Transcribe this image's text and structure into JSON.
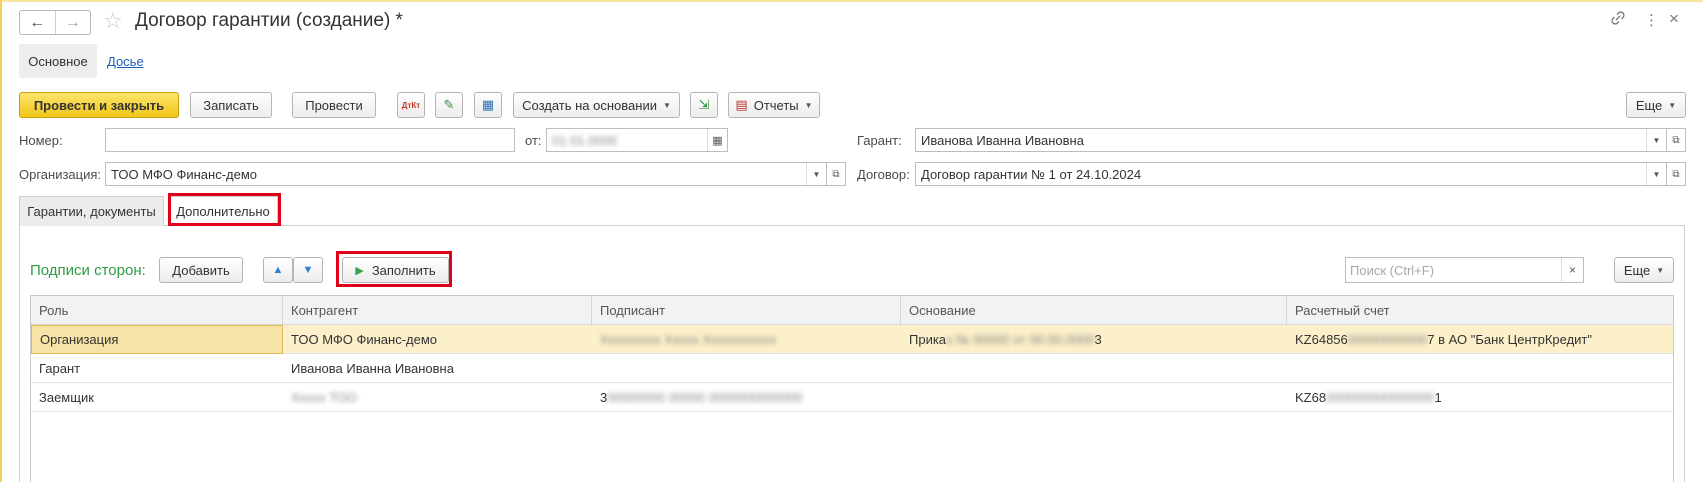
{
  "window": {
    "title": "Договор гарантии (создание) *",
    "back_icon": "←",
    "forward_icon": "→",
    "star_icon": "☆",
    "link_icon": "🔗",
    "more_icon": "⋮",
    "close_icon": "×"
  },
  "top_tabs": {
    "main": "Основное",
    "dossier": "Досье"
  },
  "toolbar": {
    "post_close": "Провести и закрыть",
    "save": "Записать",
    "post": "Провести",
    "create_based": "Создать на основании",
    "reports": "Отчеты",
    "more": "Еще",
    "dt_kt_icon": "ДтКт",
    "edit_icon": "✎",
    "struct_icon": "▦",
    "export_icon": "⇲",
    "report_icon": "▤"
  },
  "form": {
    "number_label": "Номер:",
    "number_value": "",
    "date_label": "от:",
    "date_value": "01.01.0000",
    "guarantor_label": "Гарант:",
    "guarantor_value": "Иванова Иванна Ивановна",
    "org_label": "Организация:",
    "org_value": "ТОО МФО Финанс-демо",
    "contract_label": "Договор:",
    "contract_value": "Договор гарантии № 1 от 24.10.2024"
  },
  "inner_tabs": {
    "guarantees": "Гарантии, документы",
    "additional": "Дополнительно"
  },
  "signers": {
    "label": "Подписи сторон:",
    "add": "Добавить",
    "up_icon": "▲",
    "down_icon": "▼",
    "fill": "Заполнить",
    "fill_icon": "▶",
    "search_placeholder": "Поиск (Ctrl+F)",
    "more": "Еще"
  },
  "table": {
    "columns": [
      "Роль",
      "Контрагент",
      "Подписант",
      "Основание",
      "Расчетный счет"
    ],
    "rows": [
      {
        "role": "Организация",
        "counterparty": "ТОО МФО Финанс-демо",
        "signer": "Ххххххххх Ххххх Ххххххххххх",
        "basis_prefix": "Прика",
        "basis_hidden": "з № 00000 от 00.00.0000",
        "basis_suffix": "3",
        "account_prefix": "KZ64856",
        "account_hidden": "00000000000",
        "account_suffix": "7 в АО \"Банк ЦентрКредит\""
      },
      {
        "role": "Гарант",
        "counterparty": "Иванова Иванна Ивановна",
        "signer": "",
        "basis_prefix": "",
        "basis_hidden": "",
        "basis_suffix": "",
        "account_prefix": "",
        "account_hidden": "",
        "account_suffix": ""
      },
      {
        "role": "Заемщик",
        "counterparty": "Ххххх ТОО",
        "signer": "3",
        "signer_hidden": "00000000 00000 0000000000000",
        "basis_prefix": "",
        "basis_hidden": "",
        "basis_suffix": "",
        "account_prefix": "KZ68",
        "account_hidden": "000000000000000",
        "account_suffix": "1"
      }
    ]
  }
}
